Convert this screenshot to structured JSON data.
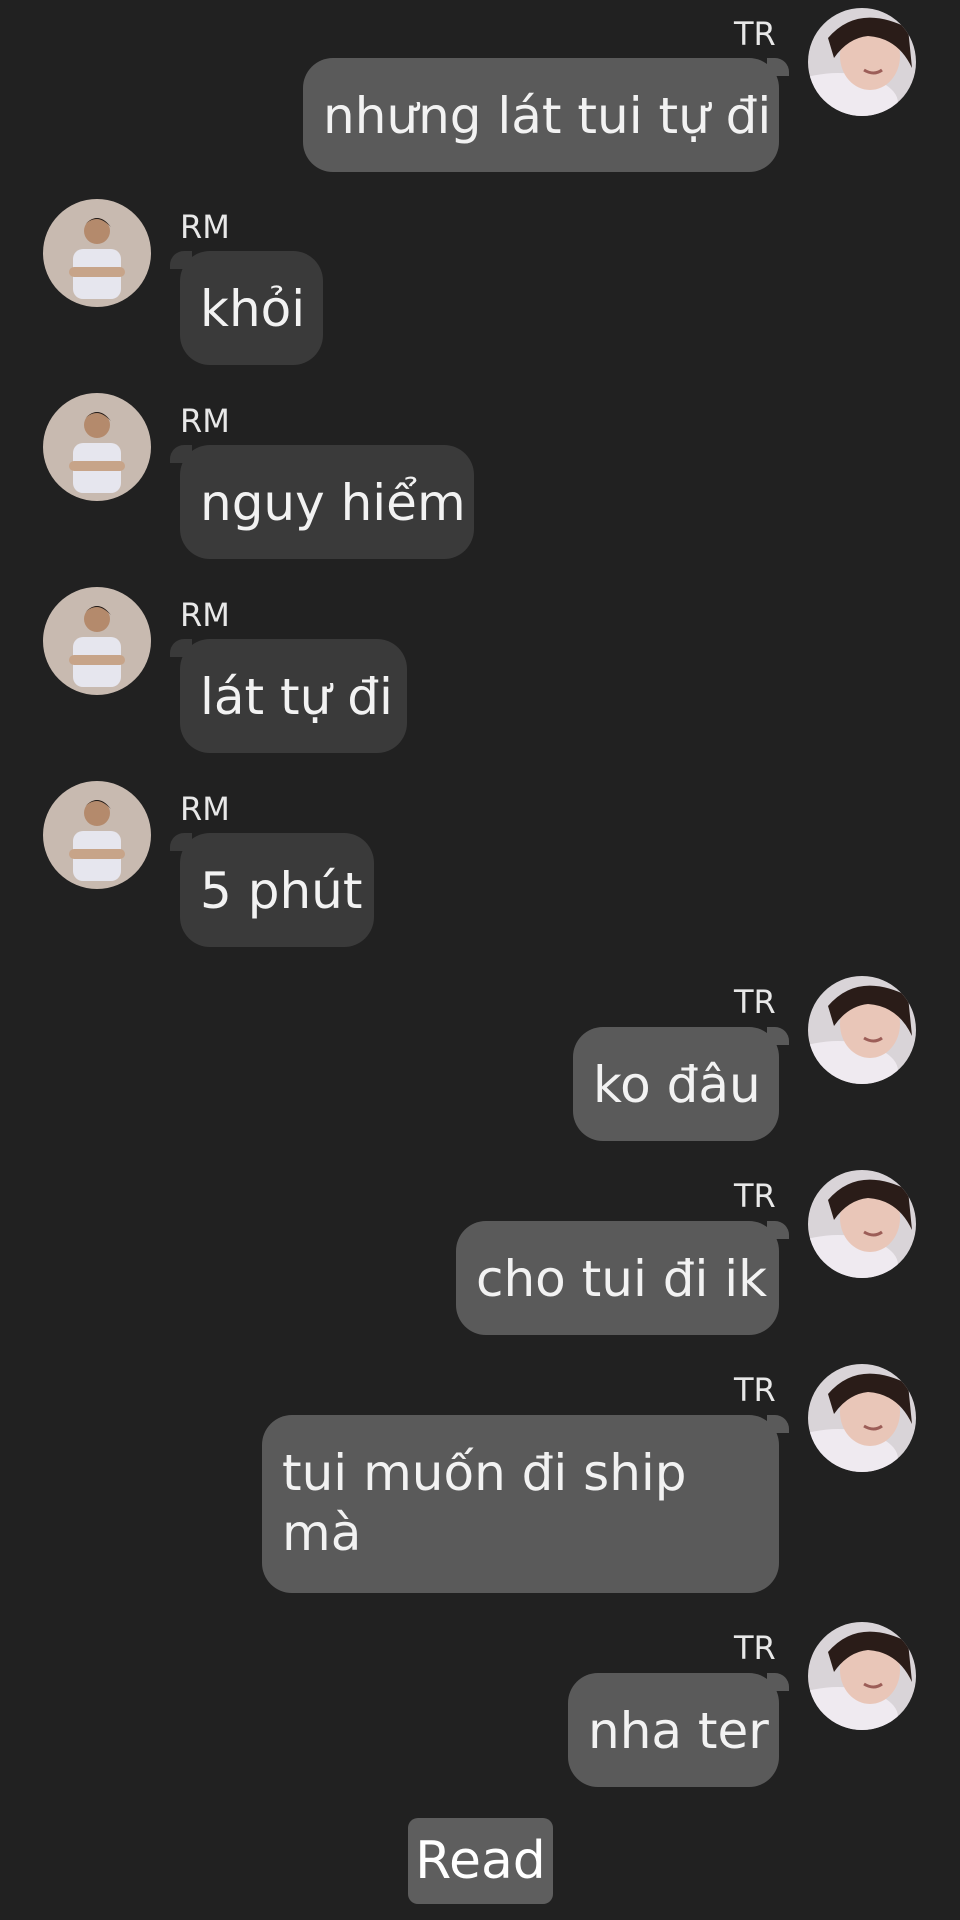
{
  "participants": {
    "me": {
      "name": "TR",
      "avatar_icon": "avatar-tr-icon"
    },
    "other": {
      "name": "RM",
      "avatar_icon": "avatar-rm-icon"
    }
  },
  "messages": [
    {
      "sender": "TR",
      "text": "nhưng lát tui tự đi"
    },
    {
      "sender": "RM",
      "text": "khỏi"
    },
    {
      "sender": "RM",
      "text": "nguy hiểm"
    },
    {
      "sender": "RM",
      "text": "lát tự đi"
    },
    {
      "sender": "RM",
      "text": "5 phút"
    },
    {
      "sender": "TR",
      "text": "ko đâu"
    },
    {
      "sender": "TR",
      "text": "cho tui đi ik"
    },
    {
      "sender": "TR",
      "text": "tui muốn đi ship mà"
    },
    {
      "sender": "TR",
      "text": "nha ter"
    }
  ],
  "status": {
    "read_label": "Read"
  },
  "colors": {
    "background": "#212121",
    "incoming_bubble": "#3a3a3a",
    "outgoing_bubble": "#5a5a5a",
    "read_badge": "#5e5e5e"
  }
}
